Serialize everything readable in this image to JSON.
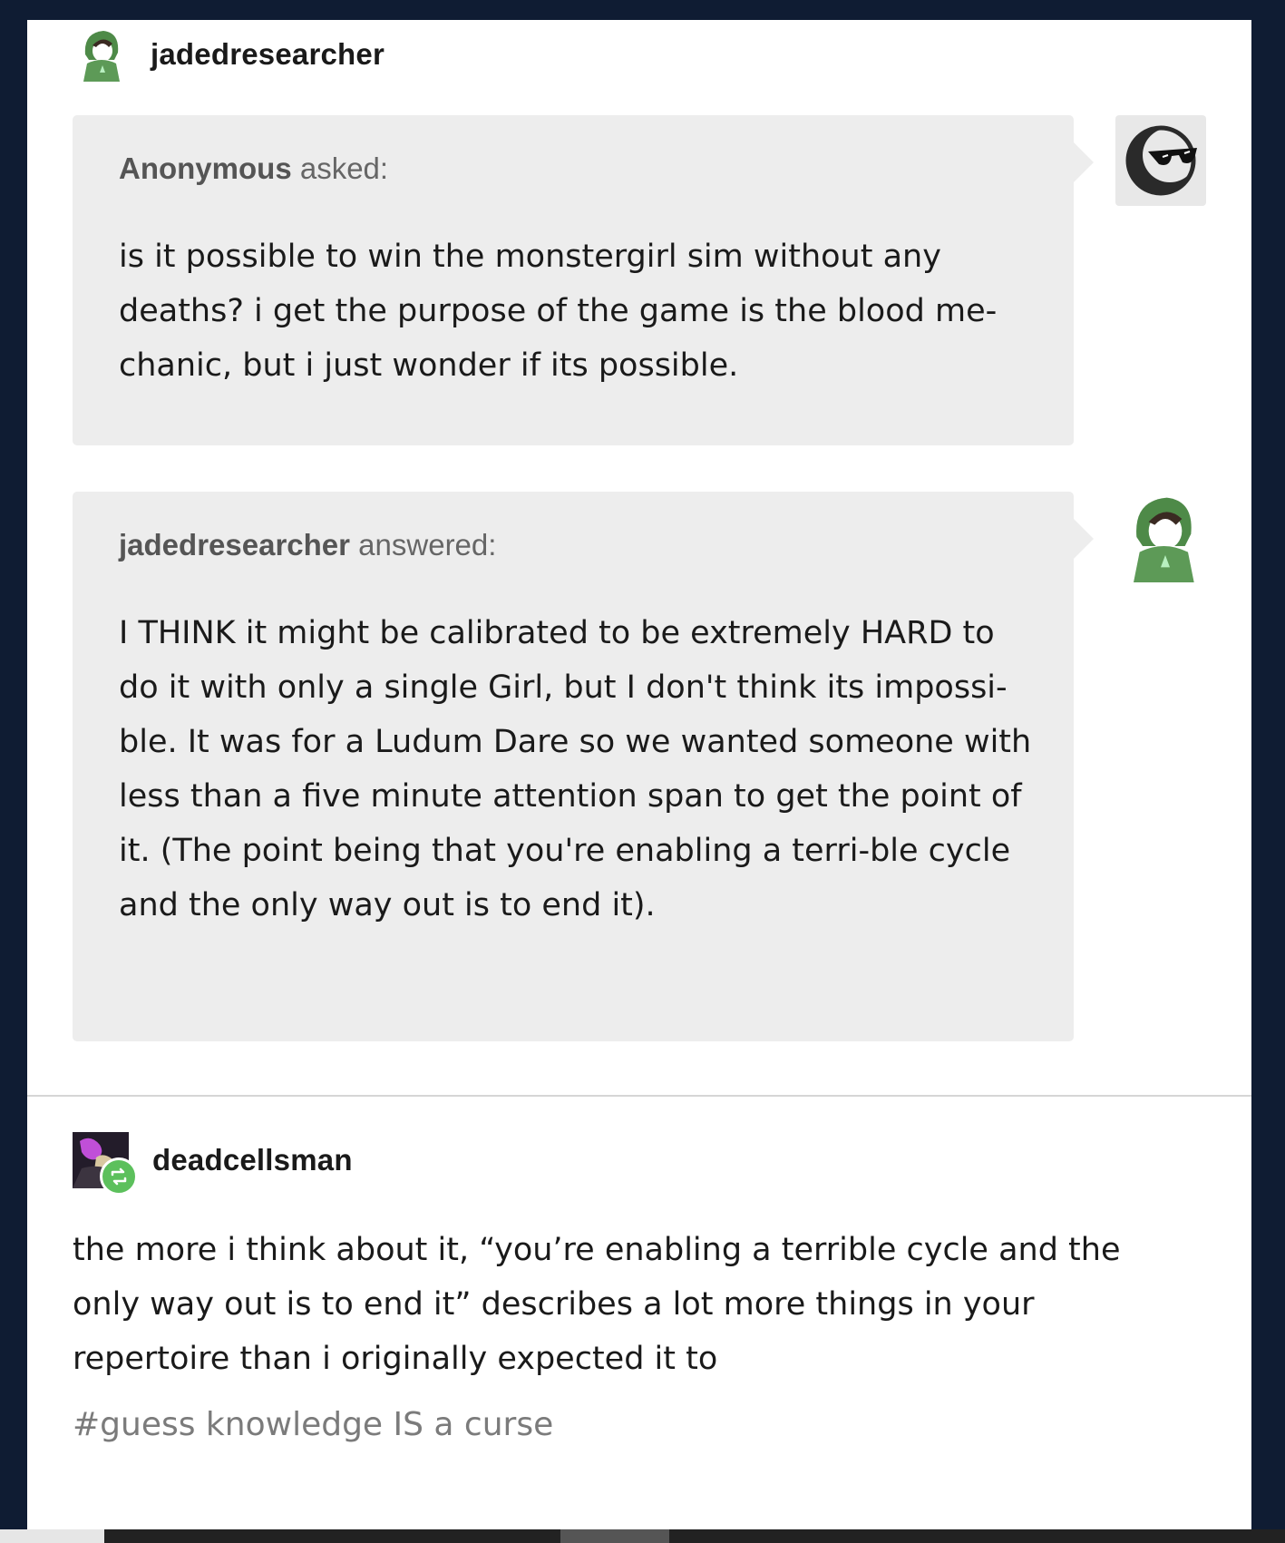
{
  "post": {
    "op_username": "jadedresearcher",
    "ask": {
      "asker_name": "Anonymous",
      "asker_verb": "asked:",
      "question": "is it possible to win the monstergirl sim without any deaths? i get the purpose of the game is the blood me-chanic, but i just wonder if its possible."
    },
    "answer": {
      "answerer_name": "jadedresearcher",
      "answerer_verb": "answered:",
      "text": "I THINK it might be calibrated to be extremely HARD to do it with only a single Girl, but I don't think its impossi-ble. It was for a Ludum Dare so we wanted someone with less than a five minute attention span to get the point of it. (The point being that you're enabling a terri-ble cycle and the only way out is to end it)."
    },
    "reblog": {
      "username": "deadcellsman",
      "reblog_badge_icon": "reblog-icon",
      "comment": "the more i think about it, “you’re enabling a terrible cycle and the only way out is to end it” describes a lot more things in your repertoire than i originally expected it to",
      "tags": "#guess knowledge IS a curse"
    }
  },
  "colors": {
    "page_background": "#0f1c33",
    "bubble_background": "#ededed",
    "reblog_badge": "#5cc05c",
    "avatar_green": "#5d9a57"
  }
}
